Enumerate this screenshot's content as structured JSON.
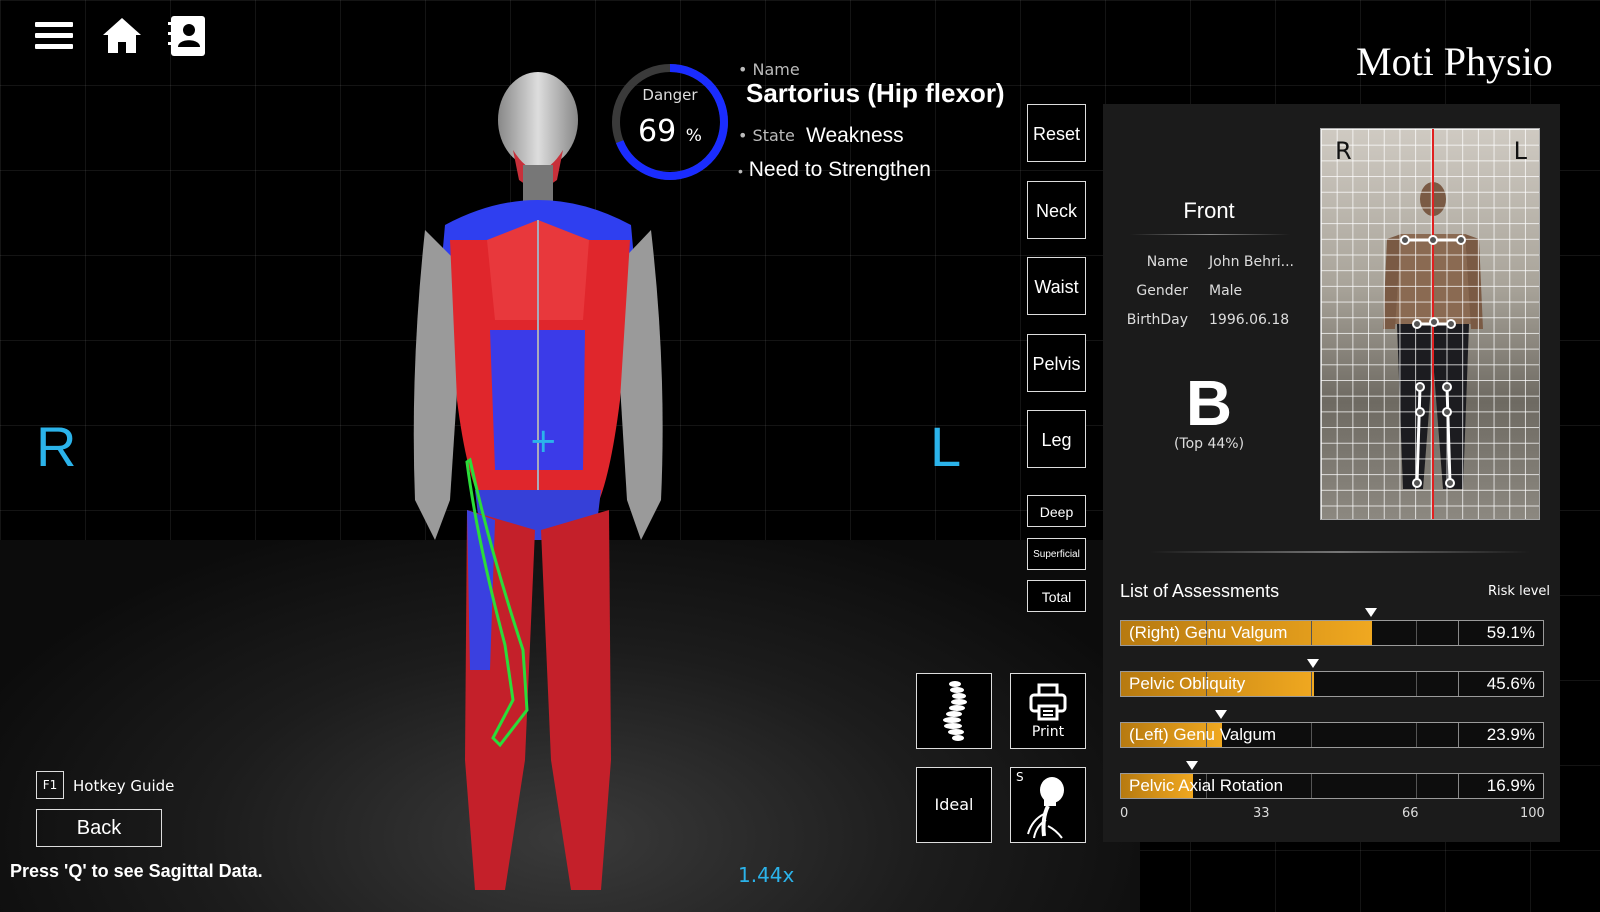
{
  "app": {
    "brand": "Moti Physio"
  },
  "icons": {
    "menu": "hamburger-menu-icon",
    "home": "home-icon",
    "profile": "contact-book-icon"
  },
  "sides": {
    "right": "R",
    "left": "L"
  },
  "danger": {
    "label": "Danger",
    "value": "69",
    "unit": "%",
    "percent": 69
  },
  "muscle": {
    "name_label": "Name",
    "name": "Sartorius (Hip flexor)",
    "state_label": "State",
    "state": "Weakness",
    "recommendation": "Need to Strengthen"
  },
  "view_buttons": [
    "Reset",
    "Neck",
    "Waist",
    "Pelvis",
    "Leg"
  ],
  "layer_buttons": [
    "Deep",
    "Superficial",
    "Total"
  ],
  "tools": {
    "print": "Print",
    "ideal": "Ideal",
    "s_label": "S"
  },
  "hotkey": {
    "key": "F1",
    "label": "Hotkey Guide"
  },
  "back": "Back",
  "hint": "Press 'Q' to see Sagittal Data.",
  "zoom": "1.44x",
  "profile": {
    "view": "Front",
    "fields": [
      {
        "k": "Name",
        "v": "John Behri..."
      },
      {
        "k": "Gender",
        "v": "Male"
      },
      {
        "k": "BirthDay",
        "v": "1996.06.18"
      }
    ],
    "grade": "B",
    "grade_note": "(Top 44%)",
    "photo_r": "R",
    "photo_l": "L"
  },
  "assessments": {
    "title": "List of Assessments",
    "risk_label": "Risk level",
    "items": [
      {
        "name": "(Right) Genu Valgum",
        "value": "59.1%",
        "level": 59.1
      },
      {
        "name": "Pelvic Obliquity",
        "value": "45.6%",
        "level": 45.6
      },
      {
        "name": "(Left) Genu Valgum",
        "value": "23.9%",
        "level": 23.9
      },
      {
        "name": "Pelvic Axial Rotation",
        "value": "16.9%",
        "level": 16.9
      }
    ],
    "scale": [
      "0",
      "33",
      "66",
      "100"
    ]
  },
  "colors": {
    "accent_blue": "#2bb3ea",
    "bar_orange": "#f0a820",
    "danger_ring": "#1a2cff"
  }
}
